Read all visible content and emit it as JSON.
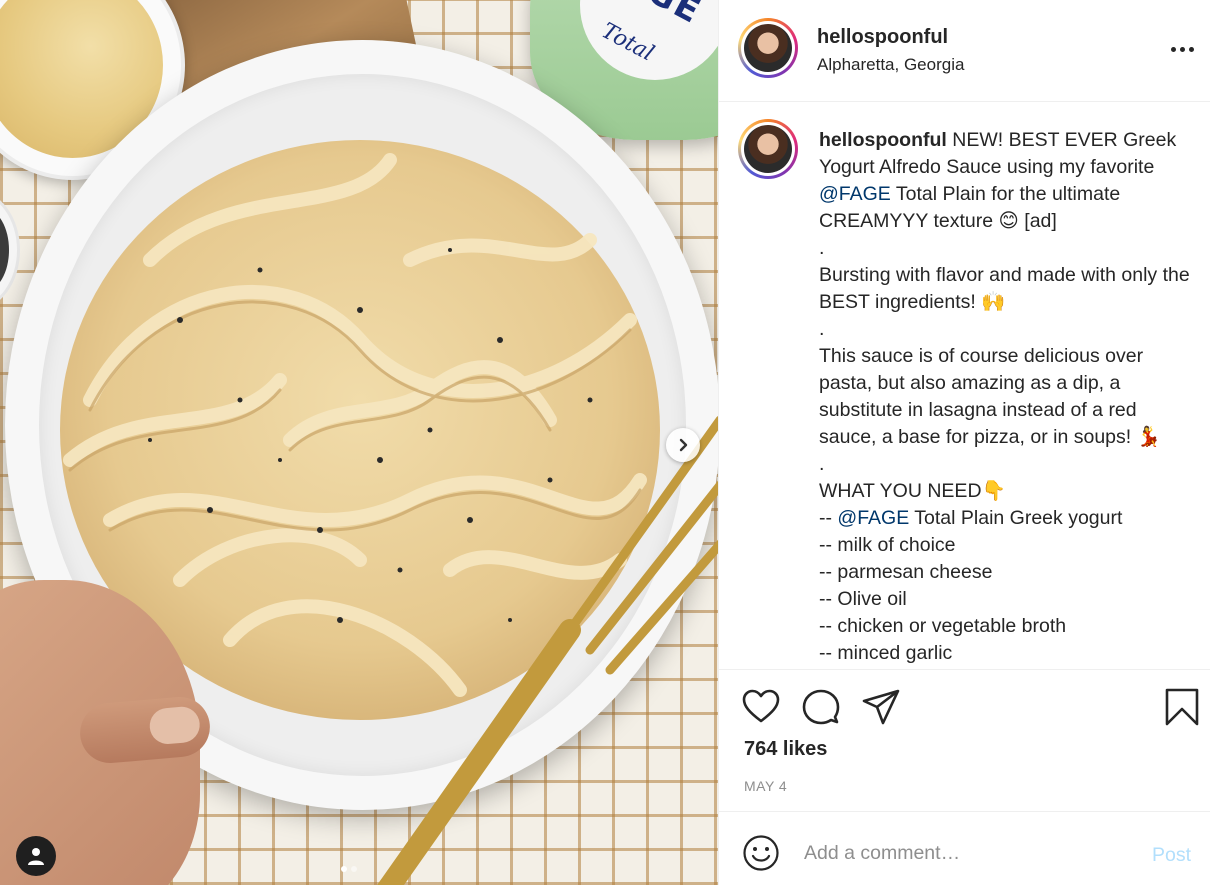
{
  "post": {
    "username": "hellospoonful",
    "location": "Alpharetta, Georgia",
    "photo_brand": "FAGE",
    "photo_brand_sub": "Total"
  },
  "caption": {
    "username": "hellospoonful",
    "line1_text": " NEW! BEST EVER Greek Yogurt Alfredo Sauce using my favorite ",
    "line1_mention": "@FAGE",
    "line1_tail": " Total Plain for the ultimate CREAMYYY texture 😊 [ad]",
    "dot1": ".",
    "para2": "Bursting with flavor and made with only the BEST ingredients! 🙌",
    "dot2": ".",
    "para3": "This sauce is of course delicious over pasta, but also amazing as a dip, a substitute in lasagna instead of a red sauce, a base for pizza, or in soups! 💃",
    "dot3": ".",
    "need_heading": "WHAT YOU NEED👇",
    "item1_prefix": "-- ",
    "item1_mention": "@FAGE",
    "item1_tail": " Total Plain Greek yogurt",
    "items": [
      "-- milk of choice",
      "-- parmesan cheese",
      "-- Olive oil",
      "-- chicken or vegetable broth",
      "-- minced garlic"
    ]
  },
  "actions": {
    "likes": "764 likes",
    "date": "MAY 4"
  },
  "comment": {
    "placeholder": "Add a comment…",
    "post_label": "Post"
  },
  "icons": {
    "like": "heart-icon",
    "comment": "comment-bubble-icon",
    "share": "paper-plane-icon",
    "save": "bookmark-icon",
    "emoji": "smiley-icon",
    "more": "more-horizontal-icon",
    "next": "chevron-right-icon",
    "tag": "user-tag-icon"
  },
  "colors": {
    "link": "#00376b",
    "post_disabled": "#b2dffc",
    "muted": "#8e8e8e",
    "text": "#262626"
  }
}
